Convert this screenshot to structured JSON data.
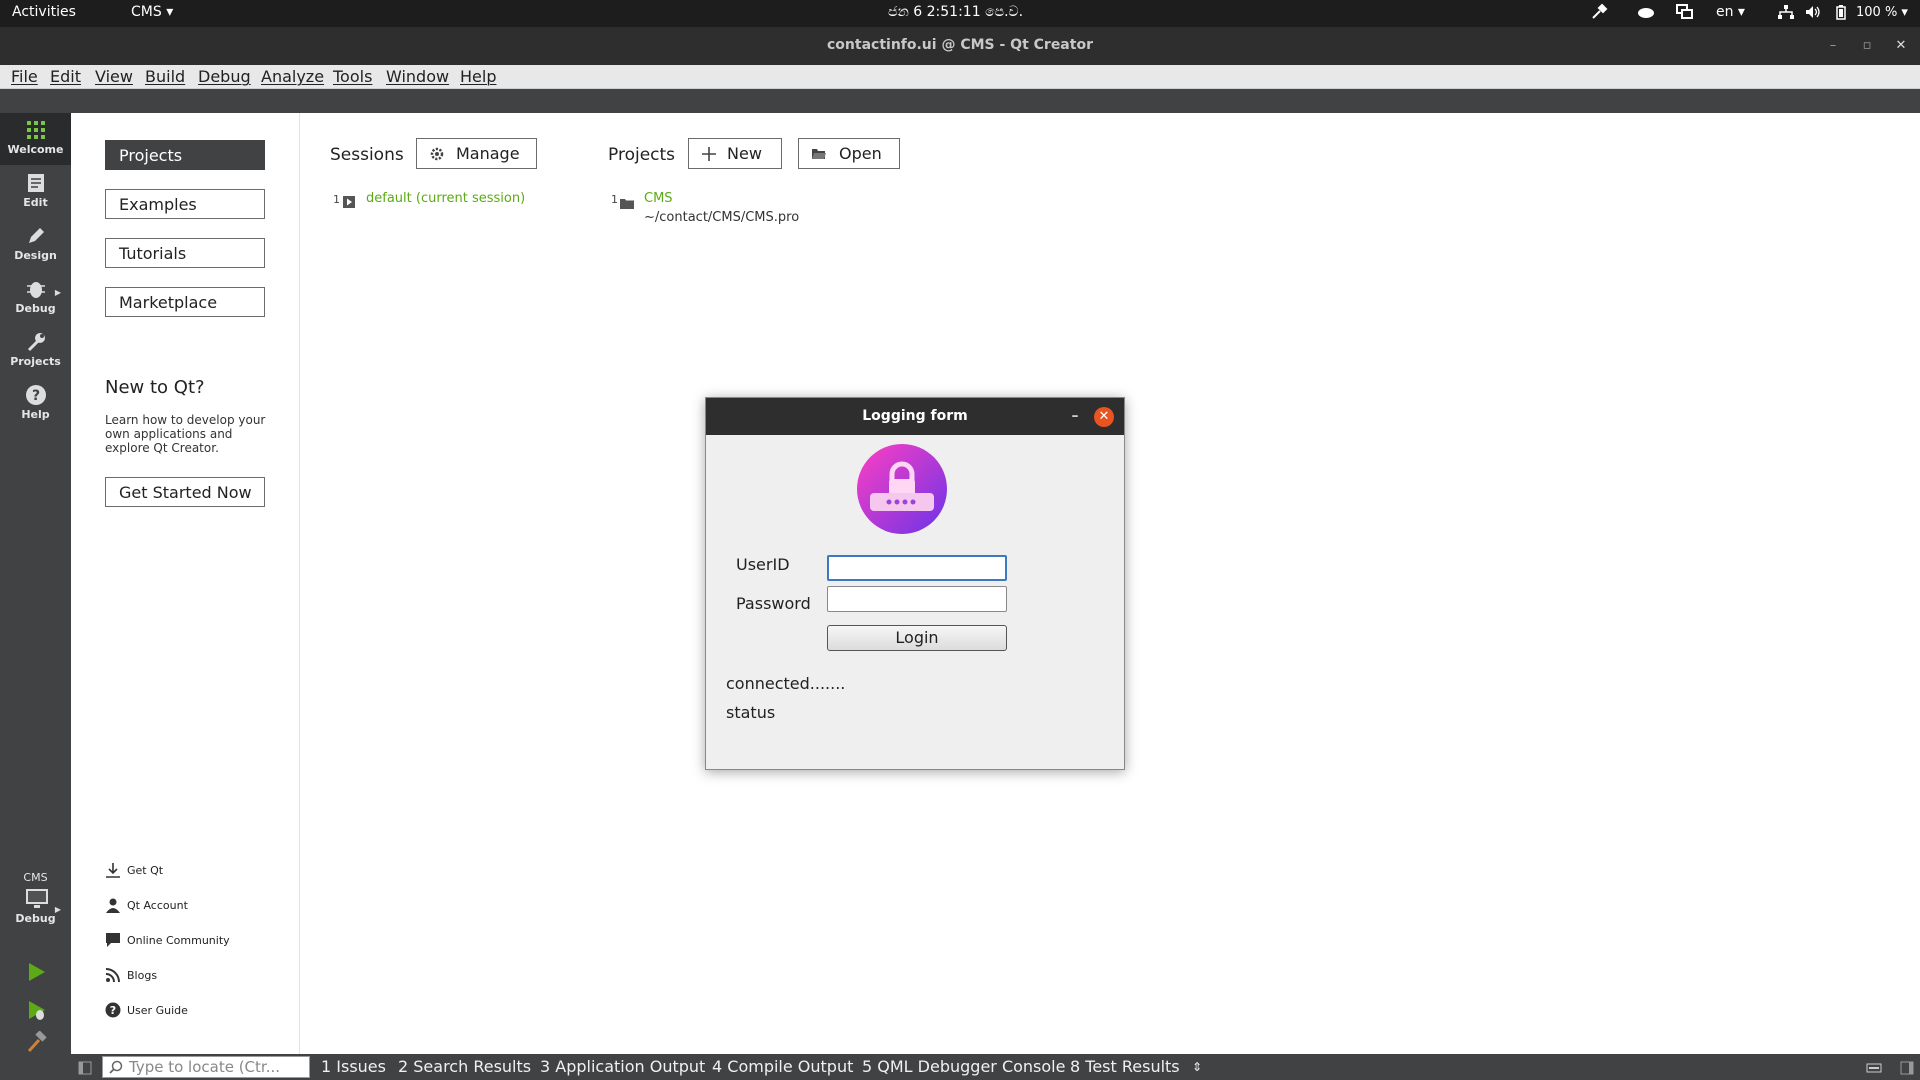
{
  "topbar": {
    "activities": "Activities",
    "app_menu": "CMS ▾",
    "clock": "ජන  6   2:51:11 පෙ.ව.",
    "lang": "en ▾",
    "battery": "100 % ▾"
  },
  "window": {
    "title": "contactinfo.ui @ CMS - Qt Creator",
    "min": "–",
    "max": "▫",
    "close": "✕"
  },
  "menu": [
    "File",
    "Edit",
    "View",
    "Build",
    "Debug",
    "Analyze",
    "Tools",
    "Window",
    "Help"
  ],
  "modes": [
    {
      "label": "Welcome",
      "icon": "grid-icon"
    },
    {
      "label": "Edit",
      "icon": "document-icon"
    },
    {
      "label": "Design",
      "icon": "pencil-icon"
    },
    {
      "label": "Debug",
      "icon": "bug-icon"
    },
    {
      "label": "Projects",
      "icon": "wrench-icon"
    },
    {
      "label": "Help",
      "icon": "help-icon"
    }
  ],
  "kit": {
    "project": "CMS",
    "config": "Debug"
  },
  "welcome": {
    "nav": [
      "Projects",
      "Examples",
      "Tutorials",
      "Marketplace"
    ],
    "new_title": "New to Qt?",
    "new_desc": "Learn how to develop your own applications and explore Qt Creator.",
    "get_started": "Get Started Now",
    "links": [
      "Get Qt",
      "Qt Account",
      "Online Community",
      "Blogs",
      "User Guide"
    ]
  },
  "sessions": {
    "header": "Sessions",
    "manage": "Manage",
    "items": [
      {
        "num": "1",
        "name": "default (current session)"
      }
    ]
  },
  "projects": {
    "header": "Projects",
    "new": "New",
    "open": "Open",
    "items": [
      {
        "num": "1",
        "name": "CMS",
        "path": "~/contact/CMS/CMS.pro"
      }
    ]
  },
  "dialog": {
    "title": "Logging form",
    "min": "–",
    "close": "✕",
    "userid_label": "UserID",
    "password_label": "Password",
    "userid_value": "",
    "password_value": "",
    "login": "Login",
    "status1": "connected.......",
    "status2": "status"
  },
  "statusbar": {
    "locator_placeholder": "Type to locate (Ctr...",
    "tabs": [
      "1  Issues",
      "2  Search Results",
      "3  Application Output",
      "4  Compile Output",
      "5  QML Debugger Console",
      "8  Test Results"
    ]
  },
  "colors": {
    "accent_green": "#5caa15",
    "close_orange": "#e95420",
    "sidebar": "#404244"
  }
}
